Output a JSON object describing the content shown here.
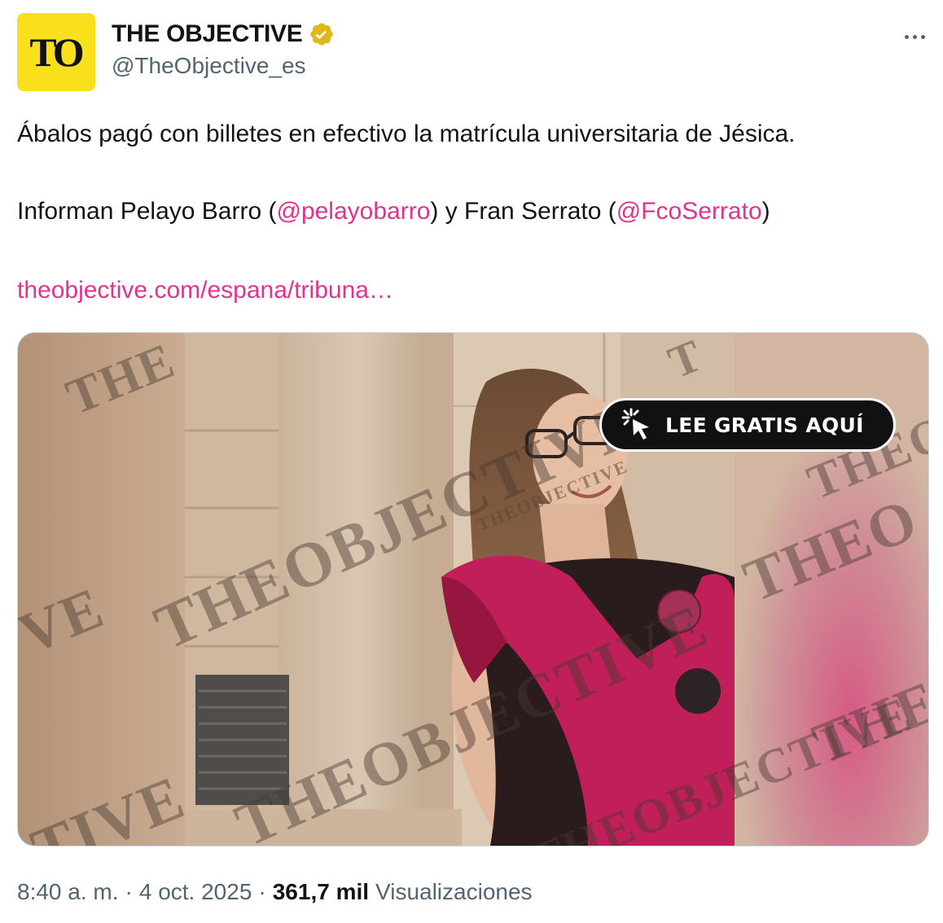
{
  "author": {
    "avatar_text": "TO",
    "display_name": "THE OBJECTIVE",
    "handle": "@TheObjective_es",
    "verified": true,
    "avatar_color": "#f8e01c",
    "verified_color": "#e2b719"
  },
  "tweet": {
    "line1": "Ábalos pagó con billetes en efectivo la matrícula universitaria de Jésica.",
    "line2_prefix": "Informan Pelayo Barro (",
    "mention1": "@pelayobarro",
    "line2_middle": ") y Fran Serrato (",
    "mention2": "@FcoSerrato",
    "line2_suffix": ")",
    "link": "theobjective.com/espana/tribuna…"
  },
  "media": {
    "cta_label": "LEE GRATIS AQUÍ",
    "cta_icon": "cursor-click-icon",
    "watermarks": [
      "THE",
      "THEOBJECTIVE",
      "VE",
      "THEOBJECTIVE",
      "THEOBJECTIVE",
      "TIVE",
      "THEO",
      "THEOBJE",
      "THEOBJECTIVE",
      "THEOBJECTIVE",
      "T"
    ]
  },
  "footer": {
    "time": "8:40 a. m.",
    "separator": "·",
    "date": "4 oct. 2025",
    "views_count": "361,7 mil",
    "views_label": "Visualizaciones"
  },
  "colors": {
    "accent_link": "#e0338c",
    "secondary_text": "#536471",
    "primary_text": "#0f1419"
  },
  "icons": {
    "more": "more-horizontal-icon",
    "verified": "verified-badge-icon"
  }
}
